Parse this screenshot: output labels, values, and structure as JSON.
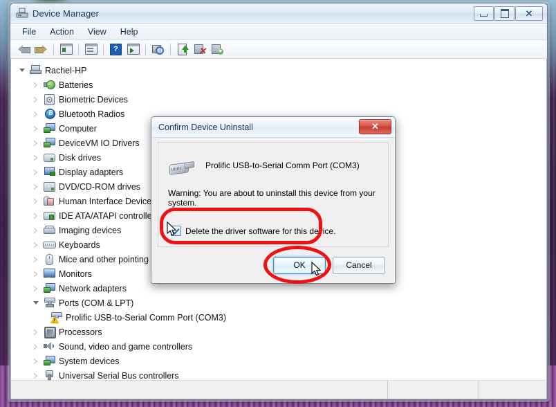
{
  "window": {
    "title": "Device Manager",
    "title_icon": "device-manager-icon",
    "controls": {
      "minimize": "minimize-button",
      "maximize": "maximize-button",
      "close": "✕"
    }
  },
  "menubar": {
    "items": [
      {
        "label": "File"
      },
      {
        "label": "Action"
      },
      {
        "label": "View"
      },
      {
        "label": "Help"
      }
    ]
  },
  "toolbar": {
    "buttons": [
      {
        "name": "back-icon"
      },
      {
        "name": "forward-icon"
      },
      {
        "name": "show-hide-console-tree-icon"
      },
      {
        "name": "properties-icon"
      },
      {
        "name": "help-icon"
      },
      {
        "name": "show-hide-action-pane-icon"
      },
      {
        "name": "scan-for-hardware-changes-icon"
      },
      {
        "name": "update-driver-software-icon"
      },
      {
        "name": "disable-device-icon"
      },
      {
        "name": "uninstall-device-icon"
      }
    ]
  },
  "tree": {
    "root": {
      "label": "Rachel-HP",
      "icon": "computer-icon",
      "expanded": true
    },
    "nodes": [
      {
        "label": "Batteries",
        "icon": "battery-icon",
        "expanded": false
      },
      {
        "label": "Biometric Devices",
        "icon": "fingerprint-icon",
        "expanded": false
      },
      {
        "label": "Bluetooth Radios",
        "icon": "bluetooth-icon",
        "expanded": false
      },
      {
        "label": "Computer",
        "icon": "computer-node-icon",
        "expanded": false
      },
      {
        "label": "DeviceVM IO Drivers",
        "icon": "network-device-icon",
        "expanded": false
      },
      {
        "label": "Disk drives",
        "icon": "disk-drive-icon",
        "expanded": false
      },
      {
        "label": "Display adapters",
        "icon": "display-adapter-icon",
        "expanded": false
      },
      {
        "label": "DVD/CD-ROM drives",
        "icon": "dvd-drive-icon",
        "expanded": false
      },
      {
        "label": "Human Interface Devices",
        "icon": "hid-icon",
        "expanded": false
      },
      {
        "label": "IDE ATA/ATAPI controllers",
        "icon": "ide-controller-icon",
        "expanded": false
      },
      {
        "label": "Imaging devices",
        "icon": "imaging-device-icon",
        "expanded": false
      },
      {
        "label": "Keyboards",
        "icon": "keyboard-icon",
        "expanded": false
      },
      {
        "label": "Mice and other pointing devices",
        "icon": "mouse-icon",
        "expanded": false
      },
      {
        "label": "Monitors",
        "icon": "monitor-icon",
        "expanded": false
      },
      {
        "label": "Network adapters",
        "icon": "network-adapter-icon",
        "expanded": false
      },
      {
        "label": "Ports (COM & LPT)",
        "icon": "port-icon",
        "expanded": true
      },
      {
        "label": "Processors",
        "icon": "processor-icon",
        "expanded": false
      },
      {
        "label": "Sound, video and game controllers",
        "icon": "sound-controller-icon",
        "expanded": false
      },
      {
        "label": "System devices",
        "icon": "system-device-icon",
        "expanded": false
      },
      {
        "label": "Universal Serial Bus controllers",
        "icon": "usb-controller-icon",
        "expanded": false
      }
    ],
    "child_of_ports": {
      "label": "Prolific USB-to-Serial Comm Port (COM3)",
      "icon": "serial-port-warning-icon",
      "has_warning": true
    }
  },
  "dialog": {
    "title": "Confirm Device Uninstall",
    "close_glyph": "✕",
    "device_icon": "serial-adapter-icon",
    "device_name": "Prolific USB-to-Serial Comm Port (COM3)",
    "warning_text": "Warning: You are about to uninstall this device from your system.",
    "checkbox": {
      "label": "Delete the driver software for this device.",
      "checked": true
    },
    "buttons": {
      "ok": "OK",
      "cancel": "Cancel"
    }
  },
  "statusbar": {
    "main": "",
    "pane2": "",
    "pane3": ""
  },
  "colors": {
    "annotation": "#ee1111",
    "titlebar_text": "#16314f",
    "dialog_close_red": "#c33a30",
    "focus_blue": "#3c8fd4"
  }
}
